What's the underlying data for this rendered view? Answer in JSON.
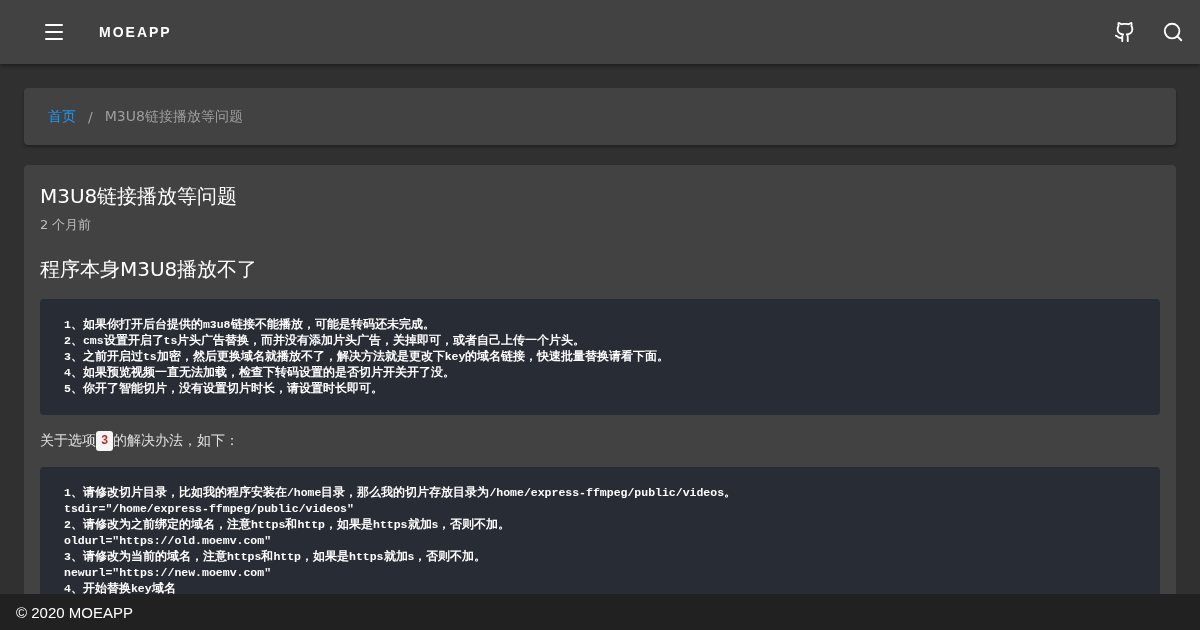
{
  "app_bar": {
    "title": "MOEAPP"
  },
  "breadcrumb_separator": "/",
  "breadcrumbs": [
    {
      "label": "首页",
      "link": true
    },
    {
      "label": "M3U8链接播放等问题",
      "link": false
    }
  ],
  "post": {
    "title": "M3U8链接播放等问题",
    "time": "2 个月前",
    "blocks": [
      {
        "kind": "heading",
        "text": "程序本身M3U8播放不了"
      },
      {
        "kind": "code",
        "lines": [
          "1、如果你打开后台提供的m3u8链接不能播放，可能是转码还未完成。",
          "2、cms设置开启了ts片头广告替换，而并没有添加片头广告，关掉即可，或者自己上传一个片头。",
          "3、之前开启过ts加密，然后更换域名就播放不了，解决方法就是更改下key的域名链接，快速批量替换请看下面。",
          "4、如果预览视频一直无法加载，检查下转码设置的是否切片开关开了没。",
          "5、你开了智能切片，没有设置切片时长，请设置时长即可。"
        ]
      },
      {
        "kind": "paragraph",
        "before": "关于选项",
        "code": "3",
        "after": "的解决办法，如下："
      },
      {
        "kind": "code",
        "lines": [
          "1、请修改切片目录，比如我的程序安装在/home目录，那么我的切片存放目录为/home/express-ffmpeg/public/videos。",
          "tsdir=\"/home/express-ffmpeg/public/videos\"",
          "2、请修改为之前绑定的域名，注意https和http，如果是https就加s，否则不加。",
          "oldurl=\"https://old.moemv.com\"",
          "3、请修改为当前的域名，注意https和http，如果是https就加s，否则不加。",
          "newurl=\"https://new.moemv.com\"",
          "4、开始替换key域名"
        ]
      }
    ]
  },
  "footer": {
    "text": "© 2020 MOEAPP"
  }
}
